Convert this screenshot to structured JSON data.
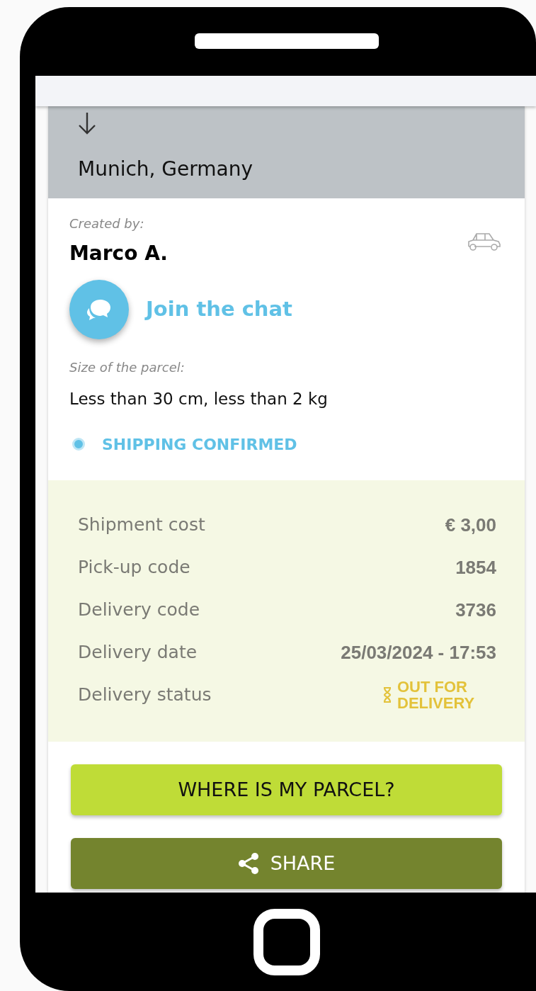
{
  "route": {
    "destination": "Munich, Germany"
  },
  "creator": {
    "label": "Created by:",
    "name": "Marco A."
  },
  "chat": {
    "label": "Join the chat"
  },
  "parcel": {
    "label": "Size of the parcel:",
    "size": "Less than 30 cm, less than 2 kg"
  },
  "shipping_status": {
    "label": "SHIPPING CONFIRMED"
  },
  "details": [
    {
      "label": "Shipment cost",
      "value": "€ 3,00",
      "kind": "text"
    },
    {
      "label": "Pick-up code",
      "value": "1854",
      "kind": "text"
    },
    {
      "label": "Delivery code",
      "value": "3736",
      "kind": "text"
    },
    {
      "label": "Delivery date",
      "value": "25/03/2024 - 17:53",
      "kind": "text"
    },
    {
      "label": "Delivery status",
      "value": "OUT FOR DELIVERY",
      "kind": "status"
    }
  ],
  "buttons": [
    {
      "label": "WHERE IS MY PARCEL?",
      "kind": "primary"
    },
    {
      "label": "SHARE",
      "kind": "share"
    }
  ]
}
